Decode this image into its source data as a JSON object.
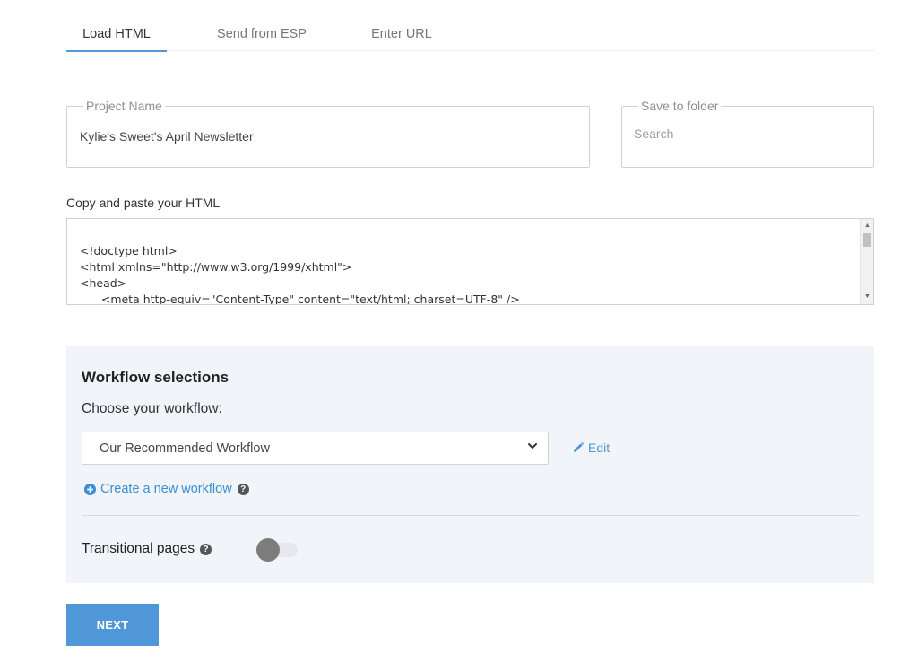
{
  "tabs": [
    {
      "label": "Load HTML",
      "active": true
    },
    {
      "label": "Send from ESP",
      "active": false
    },
    {
      "label": "Enter URL",
      "active": false
    }
  ],
  "project_name": {
    "legend": "Project Name",
    "value": "Kylie's Sweet's April Newsletter"
  },
  "save_folder": {
    "legend": "Save to folder",
    "placeholder": "Search"
  },
  "html_input": {
    "label": "Copy and paste your HTML",
    "content": "<!doctype html>\n<html xmlns=\"http://www.w3.org/1999/xhtml\">\n<head>\n      <meta http-equiv=\"Content-Type\" content=\"text/html; charset=UTF-8\" />"
  },
  "workflow": {
    "title": "Workflow selections",
    "subtitle": "Choose your workflow:",
    "selected": "Our Recommended Workflow",
    "edit_label": "Edit",
    "create_label": "Create a new workflow",
    "transitional_label": "Transitional pages",
    "transitional_enabled": false
  },
  "next_label": "NEXT",
  "colors": {
    "accent": "#4f97d6",
    "panel_bg": "#f1f5f9"
  }
}
